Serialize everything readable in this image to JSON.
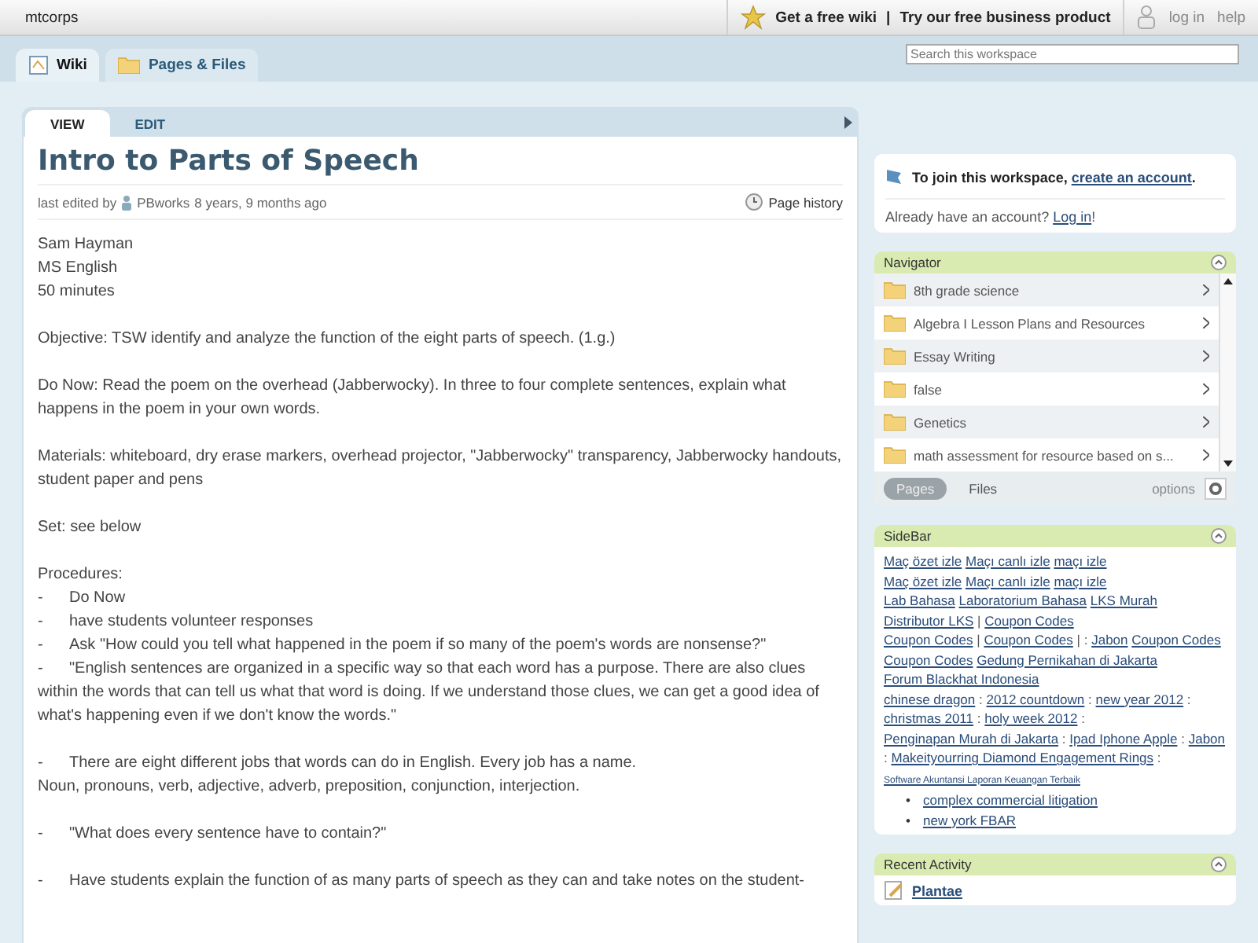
{
  "topbar": {
    "brand": "mtcorps",
    "promo": "Get a free wiki",
    "separator": "|",
    "business": "Try our free business product",
    "login": "log in",
    "help": "help"
  },
  "tabs": [
    {
      "label": "Wiki",
      "selected": true
    },
    {
      "label": "Pages & Files",
      "selected": false
    }
  ],
  "search": {
    "placeholder": "Search this workspace"
  },
  "page": {
    "modes": [
      {
        "label": "VIEW",
        "selected": true
      },
      {
        "label": "EDIT",
        "selected": false
      }
    ],
    "title": "Intro to Parts of Speech",
    "edited_prefix": "last edited by",
    "editor": "PBworks",
    "edited_when": "8 years, 9 months ago",
    "history": "Page history",
    "blocks": [
      [
        {
          "text": "Sam Hayman"
        },
        {
          "text": "MS English"
        },
        {
          "text": "50 minutes"
        }
      ],
      [
        {
          "text": "Objective: TSW identify and analyze the function of the eight parts of speech. (1.g.)"
        }
      ],
      [
        {
          "text": "Do Now: Read the poem on the overhead (Jabberwocky). In three to four complete sentences, explain what happens in the poem in your own words."
        }
      ],
      [
        {
          "text": "Materials: whiteboard, dry erase markers, overhead projector, \"Jabberwocky\" transparency, Jabberwocky handouts, student paper and pens"
        }
      ],
      [
        {
          "text": "Set: see below"
        }
      ],
      [
        {
          "text": "Procedures:"
        },
        {
          "marker": "-",
          "text": "Do Now"
        },
        {
          "marker": "-",
          "text": "have students volunteer responses"
        },
        {
          "marker": "-",
          "text": "Ask \"How could you tell what happened in the poem if so many of the poem's words are nonsense?\""
        },
        {
          "marker": "-",
          "text": "\"English sentences are organized in a specific way so that each word has a purpose. There are also clues within the words that can tell us what that word is doing. If we understand those clues, we can get a good idea of what's happening even if we don't know the words.\""
        }
      ],
      [
        {
          "marker": "-",
          "text": "There are eight different jobs that words can do in English. Every job has a name."
        },
        {
          "text": "Noun, pronouns, verb, adjective, adverb, preposition, conjunction, interjection."
        }
      ],
      [
        {
          "marker": "-",
          "text": "\"What does every sentence have to contain?\""
        }
      ],
      [
        {
          "marker": "-",
          "text": "Have students explain the function of as many parts of speech as they can and take notes on the student-"
        }
      ]
    ]
  },
  "join": {
    "prefix": "To join this workspace,",
    "link": "create an account",
    "suffix": ".",
    "have_account": "Already have an account?",
    "login": "Log in",
    "end": "!"
  },
  "navigator": {
    "title": "Navigator",
    "items": [
      {
        "label": "8th grade science"
      },
      {
        "label": "Algebra I Lesson Plans and Resources"
      },
      {
        "label": "Essay Writing"
      },
      {
        "label": "false"
      },
      {
        "label": "Genetics"
      },
      {
        "label": "math assessment for resource based on s..."
      }
    ],
    "tabs": [
      {
        "label": "Pages",
        "selected": true
      },
      {
        "label": "Files",
        "selected": false
      }
    ],
    "options": "options"
  },
  "sidebar": {
    "title": "SideBar",
    "lines": [
      [
        {
          "kind": "link",
          "text": "Maç özet izle"
        },
        {
          "kind": "link",
          "text": "Maçı canlı izle"
        },
        {
          "kind": "link",
          "text": "maçı izle"
        }
      ],
      [
        {
          "kind": "link",
          "text": "Maç özet izle"
        },
        {
          "kind": "link",
          "text": "Maçı canlı izle"
        },
        {
          "kind": "link",
          "text": "maçı izle"
        }
      ],
      [
        {
          "kind": "link",
          "text": "Lab Bahasa"
        },
        {
          "kind": "link",
          "text": "Laboratorium Bahasa"
        },
        {
          "kind": "link",
          "text": "LKS Murah"
        },
        {
          "kind": "link",
          "text": "Distributor LKS"
        },
        {
          "kind": "sep",
          "text": "|"
        },
        {
          "kind": "link",
          "text": "Coupon Codes"
        }
      ],
      [
        {
          "kind": "link",
          "text": "Coupon Codes"
        },
        {
          "kind": "sep",
          "text": "|"
        },
        {
          "kind": "link",
          "text": "Coupon Codes"
        },
        {
          "kind": "sep",
          "text": "| :"
        },
        {
          "kind": "link",
          "text": "Jabon"
        },
        {
          "kind": "link",
          "text": "Coupon Codes"
        },
        {
          "kind": "link",
          "text": "Coupon Codes"
        },
        {
          "kind": "link",
          "text": "Gedung Pernikahan di Jakarta"
        },
        {
          "kind": "link",
          "text": "Forum Blackhat Indonesia"
        }
      ],
      [
        {
          "kind": "link",
          "text": "chinese dragon"
        },
        {
          "kind": "sep",
          "text": ":"
        },
        {
          "kind": "link",
          "text": "2012 countdown"
        },
        {
          "kind": "sep",
          "text": ":"
        },
        {
          "kind": "link",
          "text": "new year 2012"
        },
        {
          "kind": "sep",
          "text": ":"
        },
        {
          "kind": "link",
          "text": "christmas 2011"
        },
        {
          "kind": "sep",
          "text": ":"
        },
        {
          "kind": "link",
          "text": "holy week 2012"
        },
        {
          "kind": "sep",
          "text": ":"
        },
        {
          "kind": "link",
          "text": "Penginapan Murah di Jakarta"
        },
        {
          "kind": "sep",
          "text": ":"
        },
        {
          "kind": "link",
          "text": "Ipad Iphone Apple"
        },
        {
          "kind": "sep",
          "text": ":"
        },
        {
          "kind": "link",
          "text": "Jabon"
        },
        {
          "kind": "sep",
          "text": ":"
        },
        {
          "kind": "link",
          "text": "Makeityourring Diamond Engagement Rings"
        },
        {
          "kind": "sep",
          "text": ":"
        },
        {
          "kind": "small",
          "text": "Software Akuntansi Laporan Keuangan Terbaik"
        }
      ]
    ],
    "bullets": [
      {
        "marker": "•",
        "text": "complex commercial litigation"
      },
      {
        "marker": "•",
        "text": "new york FBAR"
      }
    ]
  },
  "recent": {
    "title": "Recent Activity",
    "items": [
      {
        "label": "Plantae"
      }
    ]
  }
}
